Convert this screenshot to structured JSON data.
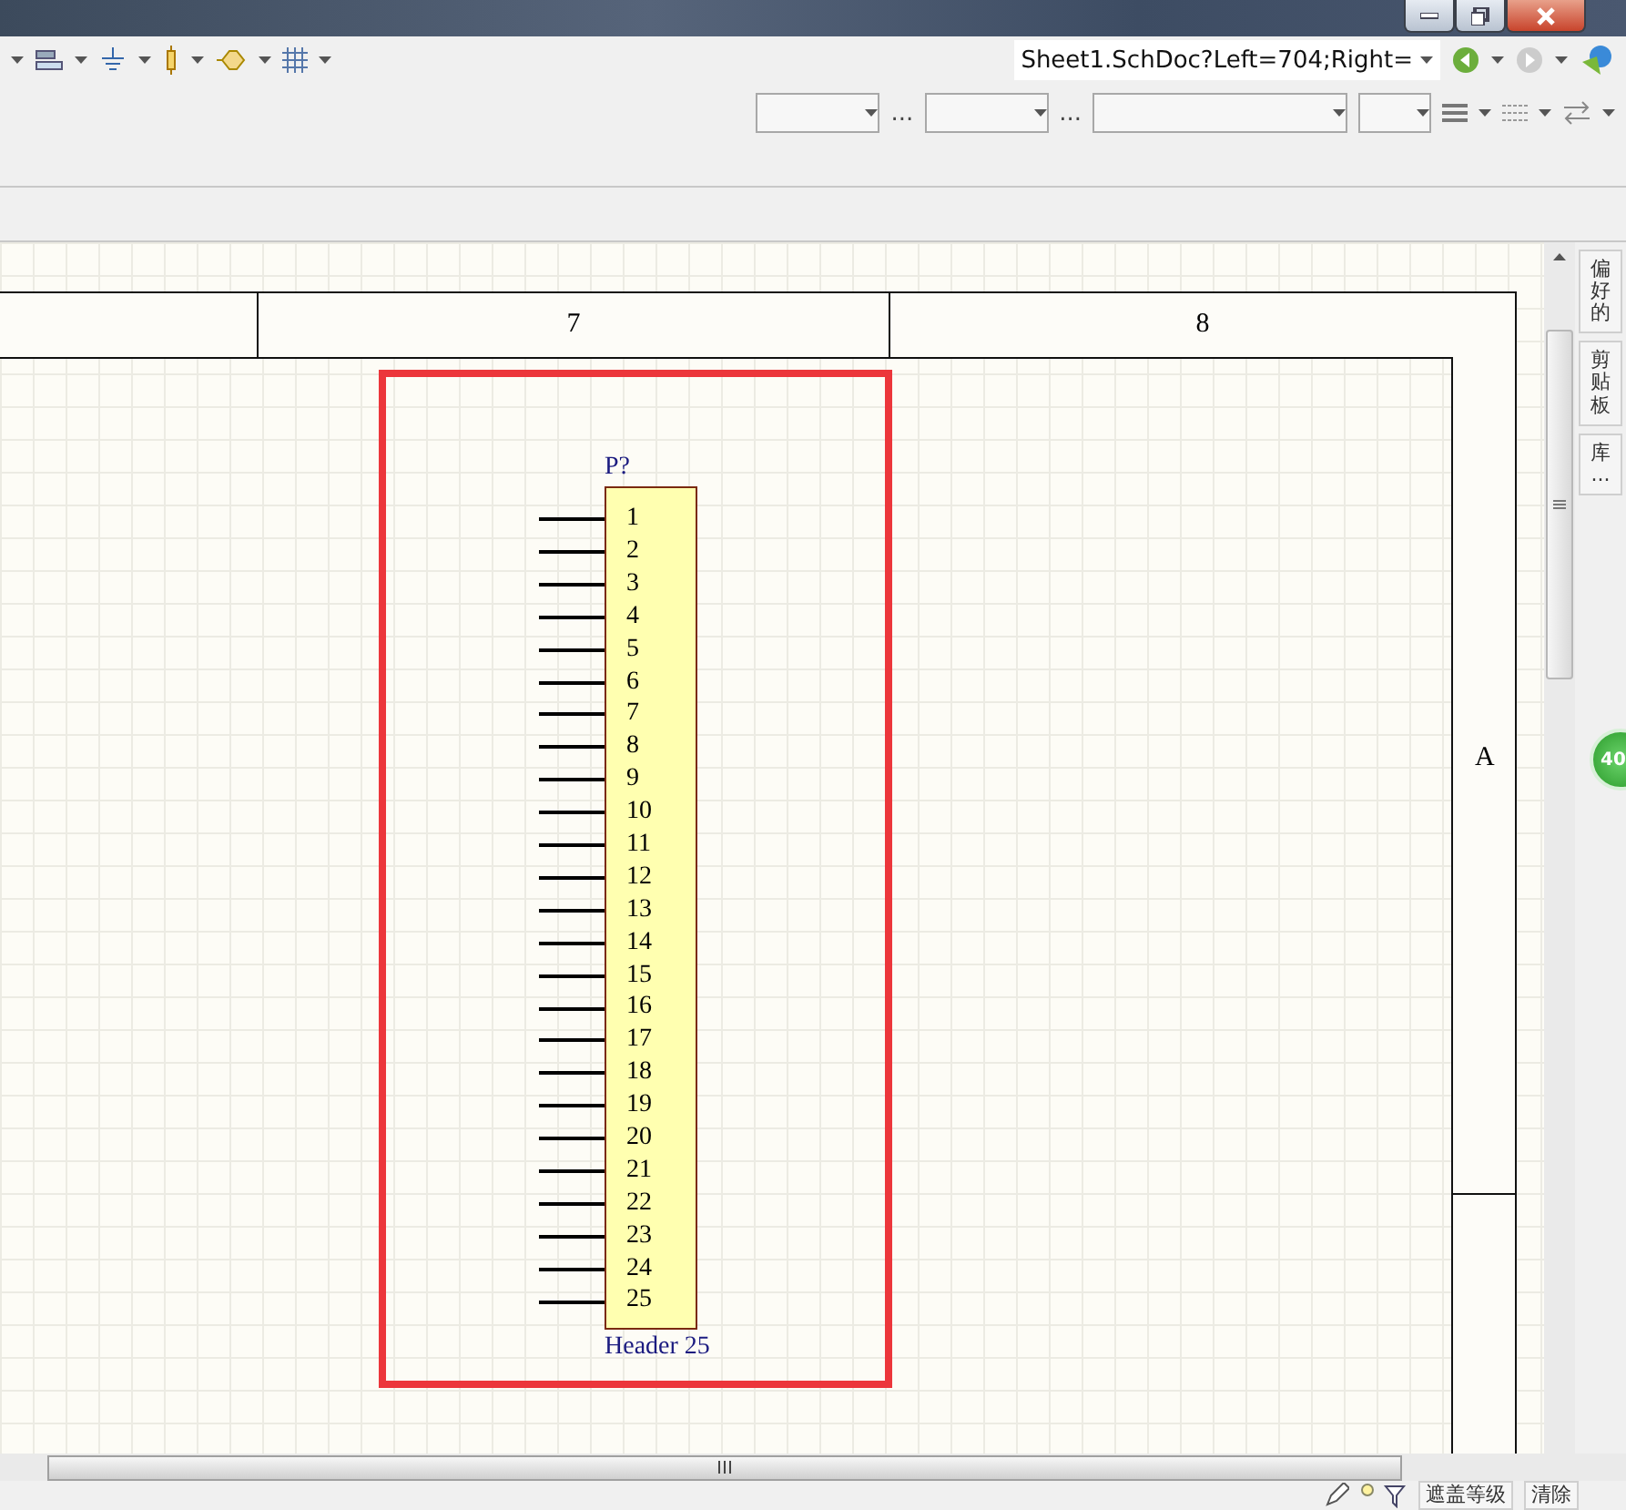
{
  "toolbar": {
    "document_path": "Sheet1.SchDoc?Left=704;Right=",
    "separators": [
      "...",
      "..."
    ]
  },
  "sheet": {
    "zones": [
      "7",
      "8"
    ],
    "rows": [
      "A"
    ]
  },
  "component": {
    "designator": "P?",
    "comment": "Header 25",
    "pins": [
      "1",
      "2",
      "3",
      "4",
      "5",
      "6",
      "7",
      "8",
      "9",
      "10",
      "11",
      "12",
      "13",
      "14",
      "15",
      "16",
      "17",
      "18",
      "19",
      "20",
      "21",
      "22",
      "23",
      "24",
      "25"
    ]
  },
  "side_panel": {
    "tabs": [
      "偏好的",
      "剪贴板",
      "库..."
    ]
  },
  "badge": "40",
  "status_bar": {
    "buttons": [
      "遮盖等级",
      "清除"
    ]
  }
}
